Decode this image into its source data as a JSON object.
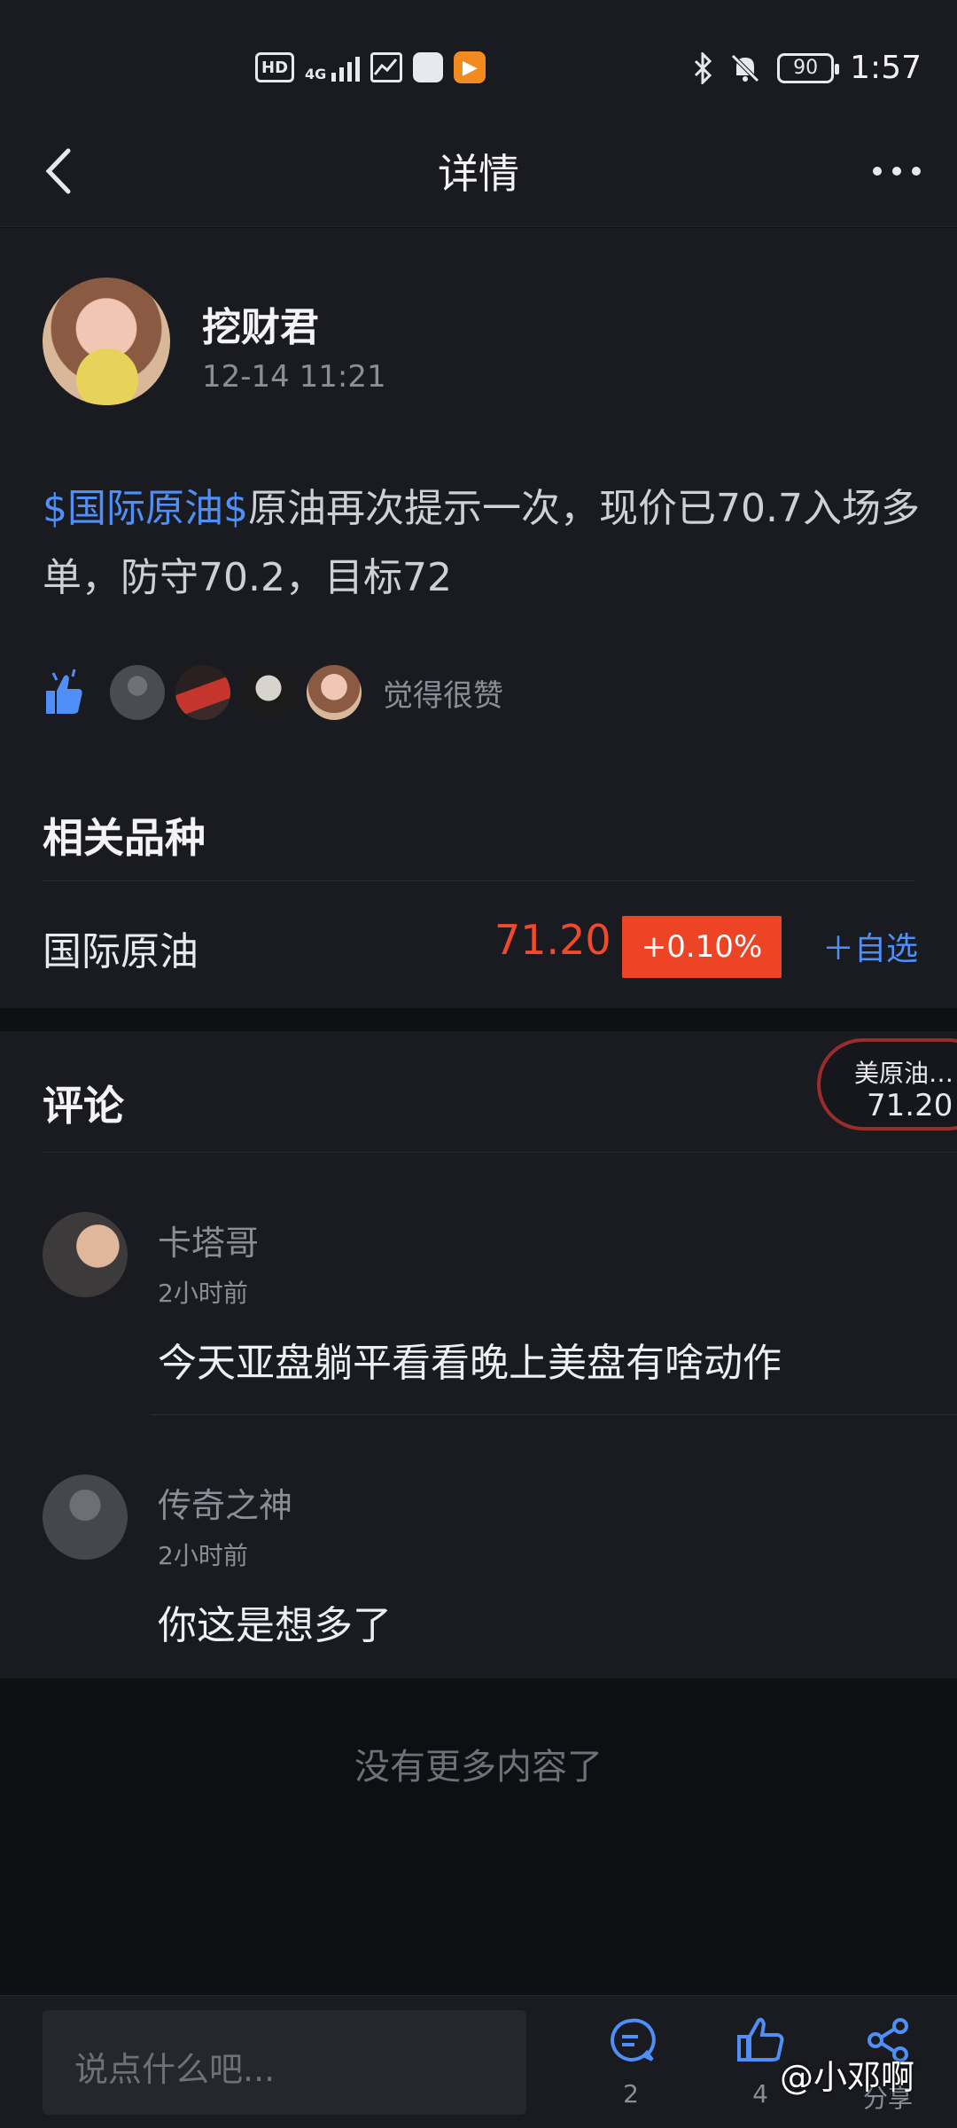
{
  "status_bar": {
    "left_icons": [
      "HD",
      "4G"
    ],
    "battery": "90",
    "time": "1:57"
  },
  "nav": {
    "title": "详情"
  },
  "post": {
    "author": "挖财君",
    "time": "12-14 11:21",
    "tag": "$国际原油$",
    "body": "原油再次提示一次，现价已70.7入场多单，防守70.2，目标72",
    "likes_text": "觉得很赞"
  },
  "related": {
    "title": "相关品种",
    "instrument_name": "国际原油",
    "price": "71.20",
    "change": "+0.10%",
    "watch_label": "＋自选"
  },
  "comments": {
    "title": "评论",
    "floating_ticker": {
      "name": "美原油…",
      "price": "71.20"
    },
    "items": [
      {
        "user": "卡塔哥",
        "time": "2小时前",
        "text": "今天亚盘躺平看看晚上美盘有啥动作"
      },
      {
        "user": "传奇之神",
        "time": "2小时前",
        "text": "你这是想多了"
      }
    ]
  },
  "end_text": "没有更多内容了",
  "bottom_bar": {
    "input_placeholder": "说点什么吧...",
    "comment_count": "2",
    "like_count": "4",
    "share_label": "分享"
  },
  "watermark": "@小邓啊",
  "colors": {
    "accent_blue": "#4f8ff7",
    "up_red": "#ee4426",
    "background": "#1a1b21"
  }
}
